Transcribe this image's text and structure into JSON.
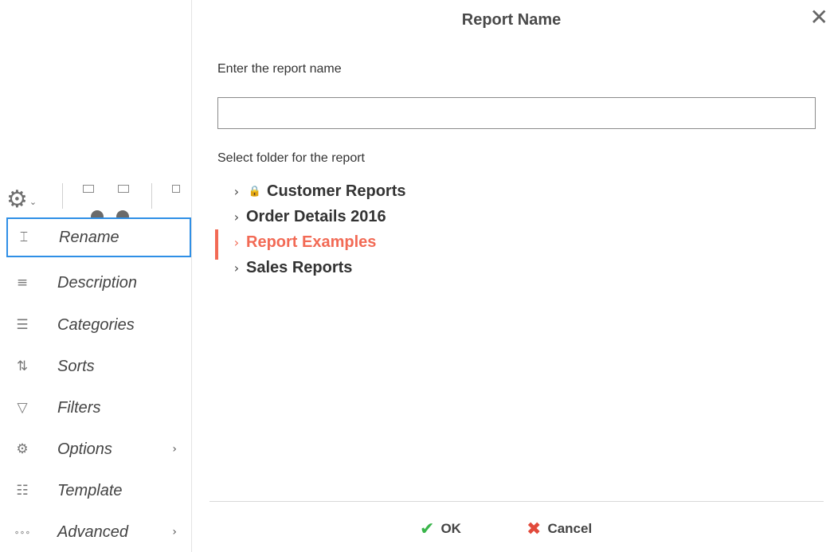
{
  "toolbar": {
    "gear_icon": "gear-icon",
    "gear_glyph": "⚙",
    "caret_glyph": "⌄"
  },
  "menu": {
    "items": [
      {
        "label": "Rename",
        "icon": "rename-icon",
        "glyph": "⌶",
        "arrow": "",
        "selected": true
      },
      {
        "label": "Description",
        "icon": "description-icon",
        "glyph": "≡",
        "arrow": ""
      },
      {
        "label": "Categories",
        "icon": "categories-icon",
        "glyph": "☰",
        "arrow": ""
      },
      {
        "label": "Sorts",
        "icon": "sort-az-icon",
        "glyph": "⇅",
        "arrow": ""
      },
      {
        "label": "Filters",
        "icon": "filter-icon",
        "glyph": "▽",
        "arrow": ""
      },
      {
        "label": "Options",
        "icon": "options-gear-icon",
        "glyph": "⚙",
        "arrow": "›"
      },
      {
        "label": "Template",
        "icon": "template-icon",
        "glyph": "☷",
        "arrow": ""
      },
      {
        "label": "Advanced",
        "icon": "more-icon",
        "glyph": "∘∘∘",
        "arrow": "›"
      }
    ],
    "selection_color": "#2f8fe6"
  },
  "dialog": {
    "title": "Report Name",
    "close_glyph": "✕",
    "name_label": "Enter the report name",
    "name_value": "",
    "name_placeholder": "",
    "folder_label": "Select folder for the report",
    "folders": [
      {
        "label": "Customer Reports",
        "locked": true,
        "active": false
      },
      {
        "label": "Order Details 2016",
        "locked": false,
        "active": false
      },
      {
        "label": "Report Examples",
        "locked": false,
        "active": true
      },
      {
        "label": "Sales Reports",
        "locked": false,
        "active": false
      }
    ],
    "chevron_glyph": "›",
    "lock_glyph": "🔒",
    "active_color": "#f26a55",
    "ok_label": "OK",
    "ok_glyph": "✔",
    "ok_color": "#39b54a",
    "cancel_label": "Cancel",
    "cancel_glyph": "✖",
    "cancel_color": "#e24a3b"
  }
}
